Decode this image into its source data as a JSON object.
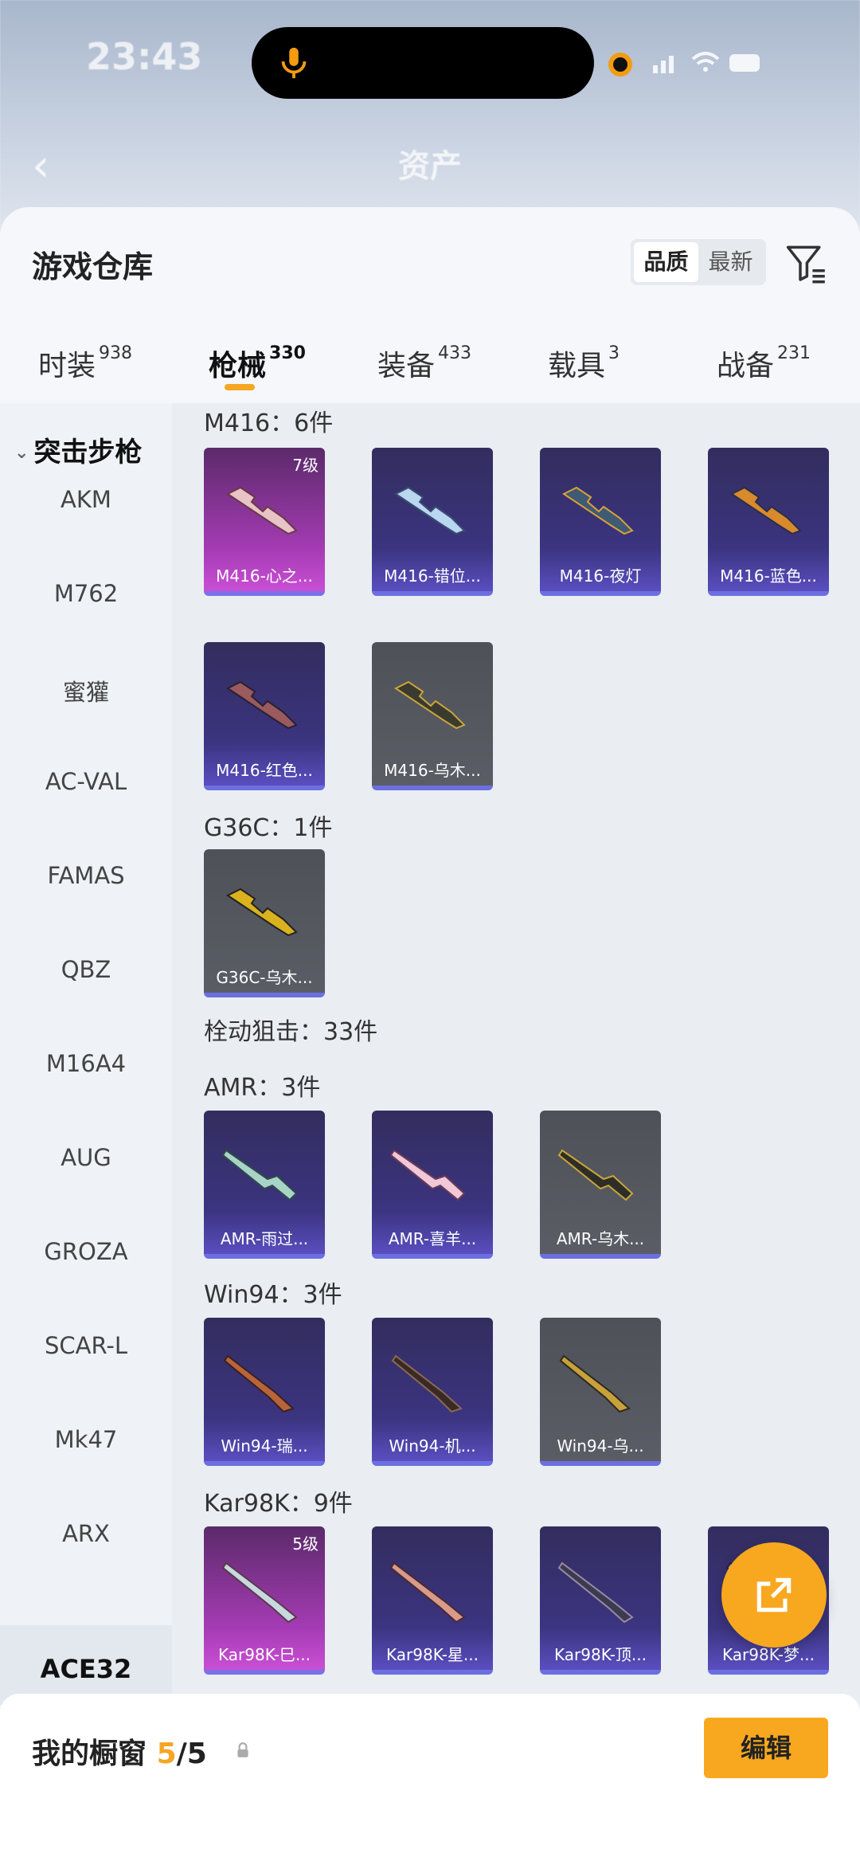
{
  "status_bar": {
    "time": "23:43"
  },
  "background_header": {
    "title": "资产"
  },
  "header": {
    "title": "游戏仓库",
    "sort_options": [
      "品质",
      "最新"
    ],
    "sort_active": "品质"
  },
  "tabs": [
    {
      "label": "时装",
      "count": "938"
    },
    {
      "label": "枪械",
      "count": "330",
      "active": true
    },
    {
      "label": "装备",
      "count": "433"
    },
    {
      "label": "载具",
      "count": "3"
    },
    {
      "label": "战备",
      "count": "231"
    }
  ],
  "sidebar": {
    "category": "突击步枪",
    "items": [
      "AKM",
      "M762",
      "蜜獾",
      "AC-VAL",
      "FAMAS",
      "QBZ",
      "M16A4",
      "AUG",
      "GROZA",
      "SCAR-L",
      "Mk47",
      "ARX",
      "ACE32"
    ]
  },
  "groups": [
    {
      "label": "M416：6件"
    },
    {
      "label": "G36C：1件"
    },
    {
      "label": "栓动狙击：33件"
    },
    {
      "label": "AMR：3件"
    },
    {
      "label": "Win94：3件"
    },
    {
      "label": "Kar98K：9件"
    }
  ],
  "items": [
    {
      "name": "M416-心之...",
      "level": "7级",
      "rarity": "pink"
    },
    {
      "name": "M416-错位...",
      "rarity": "purple"
    },
    {
      "name": "M416-夜灯",
      "rarity": "purple"
    },
    {
      "name": "M416-蓝色...",
      "rarity": "purple"
    },
    {
      "name": "M416-红色...",
      "rarity": "purple"
    },
    {
      "name": "M416-乌木...",
      "rarity": "gray"
    },
    {
      "name": "G36C-乌木...",
      "rarity": "gray"
    },
    {
      "name": "AMR-雨过...",
      "rarity": "purple"
    },
    {
      "name": "AMR-喜羊...",
      "rarity": "purple"
    },
    {
      "name": "AMR-乌木...",
      "rarity": "gray"
    },
    {
      "name": "Win94-瑞...",
      "rarity": "purple"
    },
    {
      "name": "Win94-机...",
      "rarity": "purple"
    },
    {
      "name": "Win94-乌...",
      "rarity": "gray"
    },
    {
      "name": "Kar98K-巳...",
      "level": "5级",
      "rarity": "pink"
    },
    {
      "name": "Kar98K-星...",
      "rarity": "purple"
    },
    {
      "name": "Kar98K-顶...",
      "rarity": "purple"
    },
    {
      "name": "Kar98K-梦...",
      "rarity": "purple"
    }
  ],
  "showcase": {
    "label": "我的橱窗",
    "current": "5",
    "total": "/5",
    "edit_label": "编辑"
  },
  "colors": {
    "accent": "#f7a81f"
  }
}
